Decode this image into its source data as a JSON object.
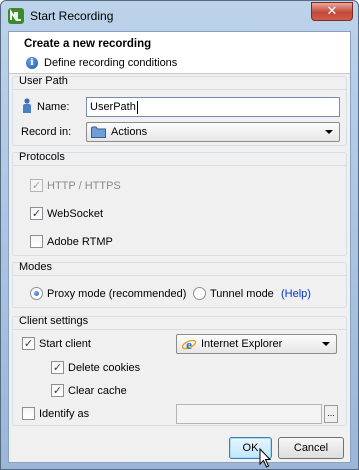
{
  "window": {
    "title": "Start Recording",
    "close_glyph": "✕"
  },
  "header": {
    "title": "Create a new recording",
    "subtitle": "Define recording conditions",
    "info_icon": "i"
  },
  "user_path": {
    "group_label": "User Path",
    "name_label": "Name:",
    "name_value": "UserPath",
    "record_in_label": "Record in:",
    "record_in_value": "Actions"
  },
  "protocols": {
    "group_label": "Protocols",
    "items": [
      {
        "label": "HTTP / HTTPS",
        "checked": true,
        "disabled": true
      },
      {
        "label": "WebSocket",
        "checked": true,
        "disabled": false
      },
      {
        "label": "Adobe RTMP",
        "checked": false,
        "disabled": false
      }
    ]
  },
  "modes": {
    "group_label": "Modes",
    "proxy_label": "Proxy mode (recommended)",
    "tunnel_label": "Tunnel mode",
    "help_link": "(Help)",
    "selected": "proxy"
  },
  "client_settings": {
    "group_label": "Client settings",
    "start_client_label": "Start client",
    "start_client_checked": true,
    "browser_value": "Internet Explorer",
    "delete_cookies_label": "Delete cookies",
    "delete_cookies_checked": true,
    "clear_cache_label": "Clear cache",
    "clear_cache_checked": true,
    "identify_as_label": "Identify as",
    "identify_as_checked": false,
    "identify_as_value": "",
    "browse_label": "..."
  },
  "footer": {
    "ok_label": "OK",
    "cancel_label": "Cancel"
  },
  "check_glyph": "✓"
}
